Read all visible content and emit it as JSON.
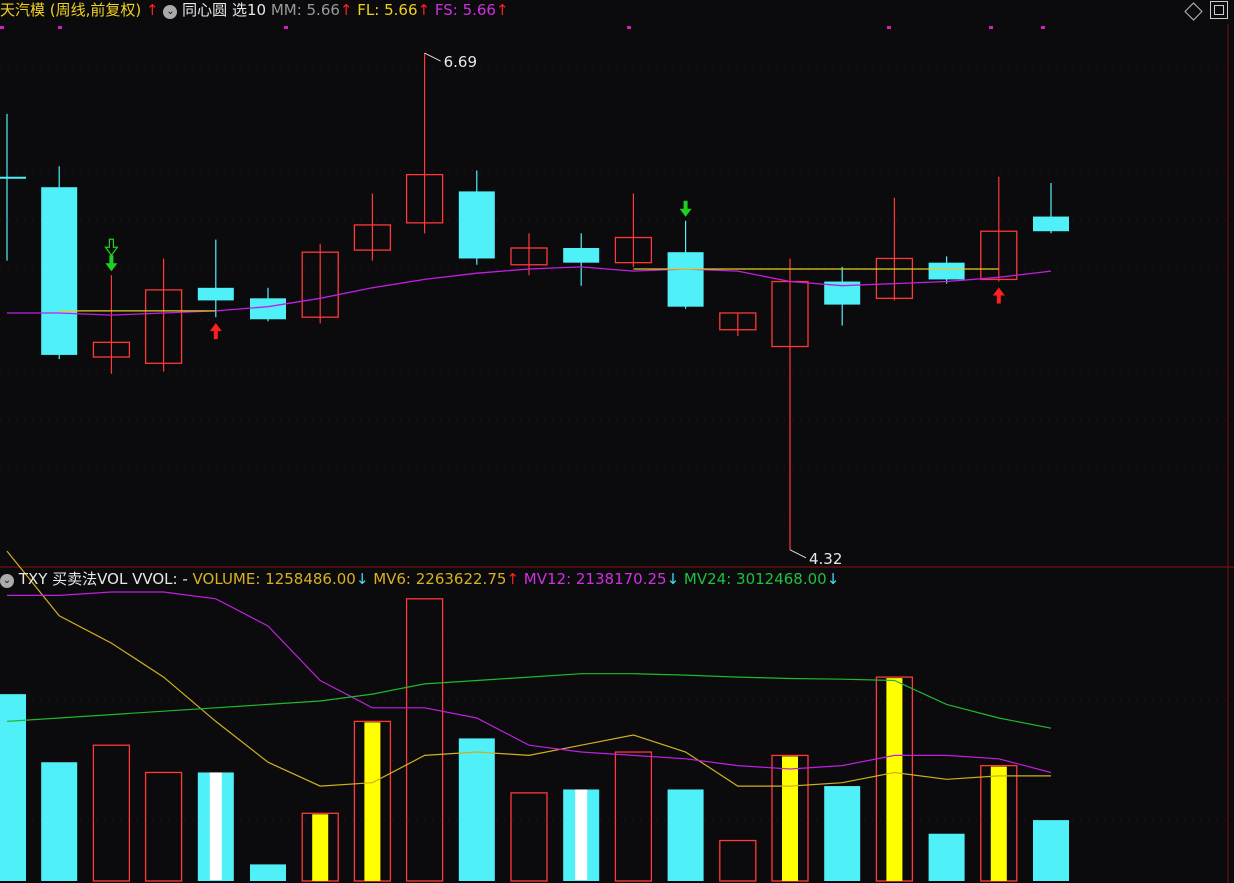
{
  "header": {
    "title": "天汽模 (周线,前复权)",
    "indicator_name": "同心圆 选10",
    "mm": "MM: 5.66",
    "fl": "FL: 5.66",
    "fs": "FS: 5.66"
  },
  "sub_header": {
    "indicator_name": "TXY 买卖法VOL VVOL: -",
    "volume": "VOLUME: 1258486.00",
    "mv6": "MV6: 2263622.75",
    "mv12": "MV12: 2138170.25",
    "mv24": "MV24: 3012468.00"
  },
  "colors": {
    "up": "#ff3838",
    "down": "#50f0f8",
    "yellow_bar": "#ffff00",
    "white_bar": "#ffffff",
    "ma_magenta": "#c020e0",
    "ma_yellow": "#e0d020",
    "ma_green": "#20b830",
    "ma_gold": "#d0b020",
    "background": "#0b0b0d",
    "grid": "#5a0a0a"
  },
  "chart_data": [
    {
      "type": "candlestick",
      "title": "天汽模 (周线,前复权)",
      "ylim": [
        4.2,
        6.8
      ],
      "candles": [
        {
          "o": 6.1,
          "c": 6.1,
          "h": 6.4,
          "l": 5.7,
          "color": "down"
        },
        {
          "o": 6.05,
          "c": 5.25,
          "h": 6.15,
          "l": 5.23,
          "color": "down"
        },
        {
          "o": 5.24,
          "c": 5.31,
          "h": 5.63,
          "l": 5.16,
          "color": "up"
        },
        {
          "o": 5.21,
          "c": 5.56,
          "h": 5.71,
          "l": 5.17,
          "color": "up"
        },
        {
          "o": 5.57,
          "c": 5.51,
          "h": 5.8,
          "l": 5.43,
          "color": "down"
        },
        {
          "o": 5.52,
          "c": 5.42,
          "h": 5.57,
          "l": 5.41,
          "color": "down"
        },
        {
          "o": 5.43,
          "c": 5.74,
          "h": 5.78,
          "l": 5.4,
          "color": "up"
        },
        {
          "o": 5.75,
          "c": 5.87,
          "h": 6.02,
          "l": 5.7,
          "color": "up"
        },
        {
          "o": 5.88,
          "c": 6.11,
          "h": 6.69,
          "l": 5.83,
          "color": "up"
        },
        {
          "o": 6.03,
          "c": 5.71,
          "h": 6.13,
          "l": 5.68,
          "color": "down"
        },
        {
          "o": 5.68,
          "c": 5.76,
          "h": 5.83,
          "l": 5.63,
          "color": "up"
        },
        {
          "o": 5.76,
          "c": 5.69,
          "h": 5.83,
          "l": 5.58,
          "color": "down"
        },
        {
          "o": 5.69,
          "c": 5.81,
          "h": 6.02,
          "l": 5.67,
          "color": "up"
        },
        {
          "o": 5.74,
          "c": 5.48,
          "h": 5.89,
          "l": 5.47,
          "color": "down"
        },
        {
          "o": 5.37,
          "c": 5.45,
          "h": 5.45,
          "l": 5.34,
          "color": "up"
        },
        {
          "o": 5.29,
          "c": 5.6,
          "h": 5.71,
          "l": 4.32,
          "color": "up"
        },
        {
          "o": 5.6,
          "c": 5.49,
          "h": 5.67,
          "l": 5.39,
          "color": "down"
        },
        {
          "o": 5.52,
          "c": 5.71,
          "h": 6.0,
          "l": 5.51,
          "color": "up"
        },
        {
          "o": 5.69,
          "c": 5.61,
          "h": 5.72,
          "l": 5.59,
          "color": "down"
        },
        {
          "o": 5.61,
          "c": 5.84,
          "h": 6.1,
          "l": 5.6,
          "color": "up"
        },
        {
          "o": 5.91,
          "c": 5.84,
          "h": 6.07,
          "l": 5.83,
          "color": "down"
        }
      ],
      "ma_magenta": [
        5.45,
        5.45,
        5.44,
        5.45,
        5.46,
        5.48,
        5.52,
        5.57,
        5.61,
        5.64,
        5.66,
        5.67,
        5.65,
        5.66,
        5.65,
        5.6,
        5.58,
        5.59,
        5.6,
        5.62,
        5.65
      ],
      "ma_yellow_segments": [
        {
          "from": 1,
          "to": 4,
          "values": [
            5.46,
            5.46,
            5.46,
            5.46
          ]
        },
        {
          "from": 12,
          "to": 19,
          "values": [
            5.66,
            5.66,
            5.66,
            5.66,
            5.66,
            5.66,
            5.66,
            5.66
          ]
        }
      ],
      "annotations": [
        {
          "index": 8,
          "text": "6.69",
          "kind": "high"
        },
        {
          "index": 15,
          "text": "4.32",
          "kind": "low"
        }
      ],
      "signals": [
        {
          "index": 2,
          "type": "sell-hollow",
          "color": "#20d020"
        },
        {
          "index": 2,
          "type": "sell",
          "color": "#20d020"
        },
        {
          "index": 4,
          "type": "buy",
          "color": "#ff2020"
        },
        {
          "index": 13,
          "type": "sell",
          "color": "#20d020"
        },
        {
          "index": 19,
          "type": "buy",
          "color": "#ff2020"
        }
      ]
    },
    {
      "type": "bar",
      "title": "TXY 买卖法VOL",
      "ylim": [
        0,
        4200000
      ],
      "volumes": [
        {
          "v": 2700000,
          "color": "down"
        },
        {
          "v": 1700000,
          "color": "down"
        },
        {
          "v": 1950000,
          "color": "up"
        },
        {
          "v": 1550000,
          "color": "up"
        },
        {
          "v": 1550000,
          "color": "down",
          "inner": "white"
        },
        {
          "v": 200000,
          "color": "down"
        },
        {
          "v": 950000,
          "color": "up",
          "inner": "yellow"
        },
        {
          "v": 2300000,
          "color": "up",
          "inner": "yellow"
        },
        {
          "v": 4100000,
          "color": "up"
        },
        {
          "v": 2050000,
          "color": "down"
        },
        {
          "v": 1250000,
          "color": "up"
        },
        {
          "v": 1300000,
          "color": "down",
          "inner": "white"
        },
        {
          "v": 1850000,
          "color": "up"
        },
        {
          "v": 1300000,
          "color": "down"
        },
        {
          "v": 550000,
          "color": "up"
        },
        {
          "v": 1800000,
          "color": "up",
          "inner": "yellow"
        },
        {
          "v": 1350000,
          "color": "down"
        },
        {
          "v": 2950000,
          "color": "up",
          "inner": "yellow"
        },
        {
          "v": 650000,
          "color": "down"
        },
        {
          "v": 1650000,
          "color": "up",
          "inner": "yellow"
        },
        {
          "v": 850000,
          "color": "down"
        }
      ],
      "mv6": [
        4800000,
        3850000,
        3450000,
        2950000,
        2300000,
        1700000,
        1350000,
        1400000,
        1800000,
        1850000,
        1800000,
        1950000,
        2100000,
        1850000,
        1350000,
        1350000,
        1400000,
        1550000,
        1450000,
        1500000,
        1500000
      ],
      "mv12": [
        4150000,
        4150000,
        4200000,
        4200000,
        4100000,
        3700000,
        2900000,
        2500000,
        2500000,
        2350000,
        1950000,
        1850000,
        1800000,
        1750000,
        1650000,
        1600000,
        1650000,
        1800000,
        1800000,
        1750000,
        1550000
      ],
      "mv24": [
        2300000,
        2350000,
        2400000,
        2450000,
        2500000,
        2550000,
        2600000,
        2700000,
        2850000,
        2900000,
        2950000,
        3000000,
        3000000,
        2980000,
        2950000,
        2930000,
        2920000,
        2900000,
        2550000,
        2350000,
        2200000
      ]
    }
  ]
}
